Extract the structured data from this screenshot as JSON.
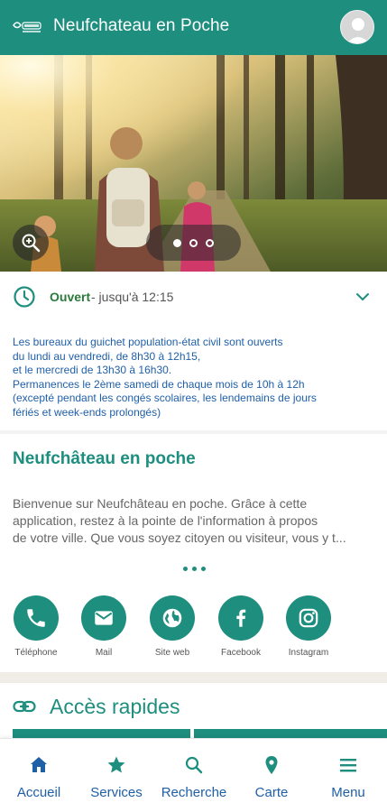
{
  "app": {
    "title": "Neufchateau en Poche",
    "logo_icon": "neufchateau-logo",
    "avatar_icon": "user-avatar-icon"
  },
  "hero": {
    "zoom_icon": "zoom-in-icon",
    "slides_total": 3,
    "slide_active": 1
  },
  "hours": {
    "status": "Ouvert",
    "until": " - jusqu'à 12:15",
    "note_lines": [
      "Les bureaux du guichet population-état civil sont ouverts",
      "du lundi au vendredi, de 8h30 à 12h15,",
      "et le mercredi de 13h30 à 16h30.",
      "Permanences le 2ème samedi de chaque mois de 10h à 12h",
      "(excepté pendant les congés scolaires, les lendemains de jours",
      "fériés et week-ends prolongés)"
    ]
  },
  "intro": {
    "title": "Neufchâteau en poche",
    "lines": [
      "Bienvenue sur Neufchâteau en poche. Grâce à cette",
      "application, restez à la pointe de l'information à propos",
      "de votre ville. Que vous soyez citoyen ou visiteur, vous y t..."
    ]
  },
  "contacts": [
    {
      "label": "Téléphone",
      "icon": "phone-icon"
    },
    {
      "label": "Mail",
      "icon": "mail-icon"
    },
    {
      "label": "Site web",
      "icon": "globe-icon"
    },
    {
      "label": "Facebook",
      "icon": "facebook-icon"
    },
    {
      "label": "Instagram",
      "icon": "instagram-icon"
    }
  ],
  "quick_access": {
    "title": "Accès rapides",
    "icon": "link-icon"
  },
  "nav": [
    {
      "label": "Accueil",
      "icon": "home-icon"
    },
    {
      "label": "Services",
      "icon": "star-icon"
    },
    {
      "label": "Recherche",
      "icon": "search-icon"
    },
    {
      "label": "Carte",
      "icon": "map-pin-icon"
    },
    {
      "label": "Menu",
      "icon": "menu-icon"
    }
  ],
  "colors": {
    "primary": "#1e8e7e",
    "nav_text": "#1f5fa8",
    "open_status": "#2b7a3b",
    "note_text": "#1f5fa8"
  }
}
